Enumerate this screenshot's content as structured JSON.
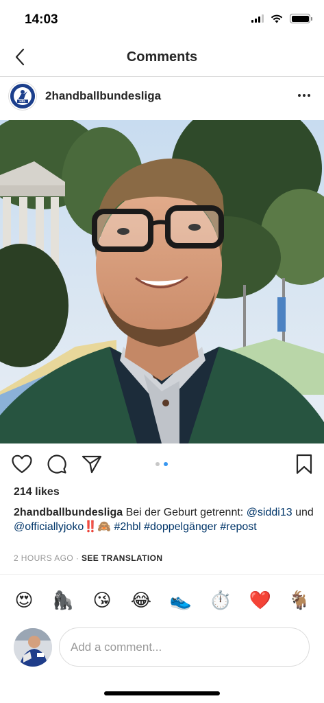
{
  "status_bar": {
    "time": "14:03",
    "icons": [
      "signal-icon",
      "wifi-icon",
      "battery-icon"
    ]
  },
  "nav": {
    "title": "Comments",
    "back_icon": "chevron-left-icon"
  },
  "post": {
    "username": "2handballbundesliga",
    "avatar_text": "HBL",
    "more_icon": "more-horizontal-icon",
    "carousel": {
      "count": 2,
      "active_index": 1
    },
    "actions": [
      "heart-icon",
      "comment-icon",
      "share-icon",
      "bookmark-icon"
    ],
    "likes": "214 likes",
    "caption": {
      "username": "2handballbundesliga",
      "text_1": " Bei der Geburt getrennt: ",
      "mention_1": "@siddi13",
      "text_2": " und ",
      "mention_2": "@officiallyjoko",
      "emoji": "‼️🙈",
      "hashtag_1": "#2hbl",
      "hashtag_2": "#doppelgänger",
      "hashtag_3": "#repost"
    },
    "timestamp": "2 HOURS AGO",
    "separator": " · ",
    "translate_label": "SEE TRANSLATION"
  },
  "reactions": [
    "😍",
    "🦍",
    "😘",
    "😂",
    "👟",
    "⏱️",
    "❤️",
    "🐐"
  ],
  "comment_box": {
    "placeholder": "Add a comment..."
  },
  "colors": {
    "link": "#003569",
    "accent": "#3897f0",
    "border": "#dbdbdb",
    "muted": "#999999"
  }
}
